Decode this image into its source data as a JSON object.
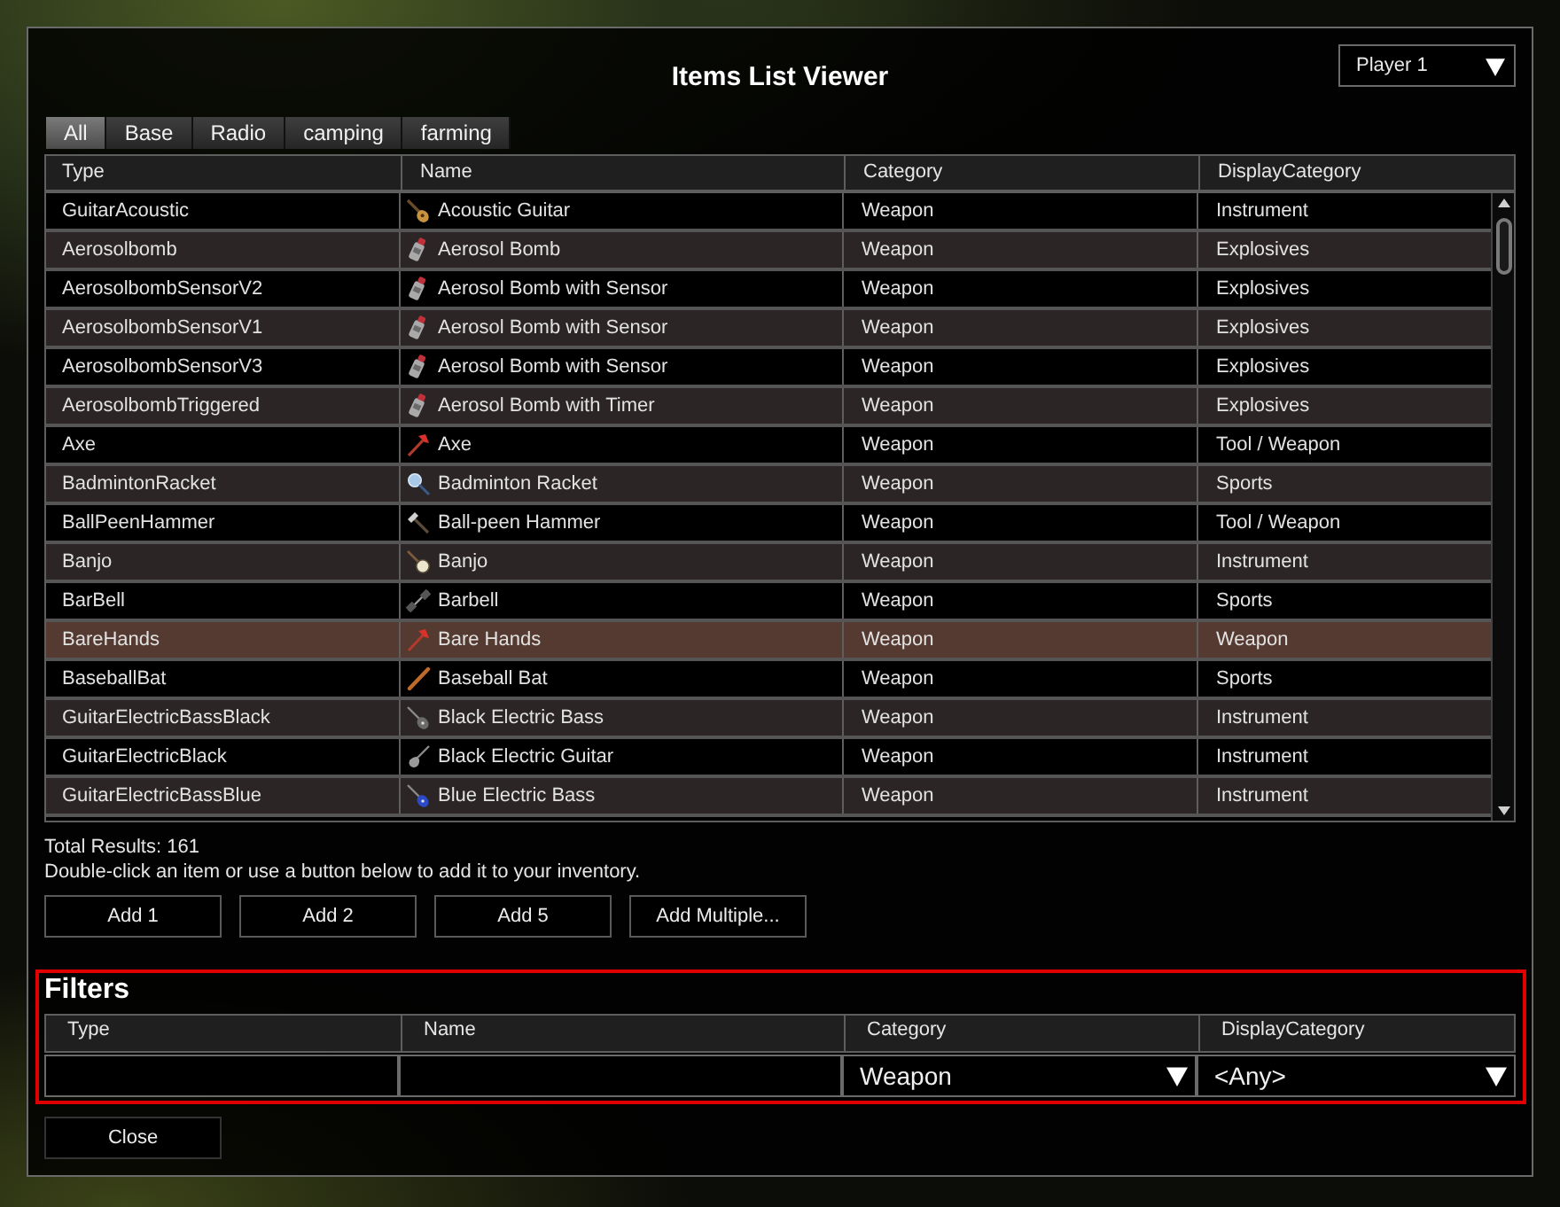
{
  "window": {
    "title": "Items List Viewer"
  },
  "player_select": {
    "value": "Player 1"
  },
  "tabs": [
    {
      "label": "All",
      "selected": true
    },
    {
      "label": "Base",
      "selected": false
    },
    {
      "label": "Radio",
      "selected": false
    },
    {
      "label": "camping",
      "selected": false
    },
    {
      "label": "farming",
      "selected": false
    }
  ],
  "table": {
    "columns": [
      "Type",
      "Name",
      "Category",
      "DisplayCategory"
    ],
    "rows": [
      {
        "type": "GuitarAcoustic",
        "name": "Acoustic Guitar",
        "category": "Weapon",
        "display_category": "Instrument",
        "selected": false
      },
      {
        "type": "Aerosolbomb",
        "name": "Aerosol Bomb",
        "category": "Weapon",
        "display_category": "Explosives",
        "selected": false
      },
      {
        "type": "AerosolbombSensorV2",
        "name": "Aerosol Bomb with Sensor",
        "category": "Weapon",
        "display_category": "Explosives",
        "selected": false
      },
      {
        "type": "AerosolbombSensorV1",
        "name": "Aerosol Bomb with Sensor",
        "category": "Weapon",
        "display_category": "Explosives",
        "selected": false
      },
      {
        "type": "AerosolbombSensorV3",
        "name": "Aerosol Bomb with Sensor",
        "category": "Weapon",
        "display_category": "Explosives",
        "selected": false
      },
      {
        "type": "AerosolbombTriggered",
        "name": "Aerosol Bomb with Timer",
        "category": "Weapon",
        "display_category": "Explosives",
        "selected": false
      },
      {
        "type": "Axe",
        "name": "Axe",
        "category": "Weapon",
        "display_category": "Tool / Weapon",
        "selected": false
      },
      {
        "type": "BadmintonRacket",
        "name": "Badminton Racket",
        "category": "Weapon",
        "display_category": "Sports",
        "selected": false
      },
      {
        "type": "BallPeenHammer",
        "name": "Ball-peen Hammer",
        "category": "Weapon",
        "display_category": "Tool / Weapon",
        "selected": false
      },
      {
        "type": "Banjo",
        "name": "Banjo",
        "category": "Weapon",
        "display_category": "Instrument",
        "selected": false
      },
      {
        "type": "BarBell",
        "name": "Barbell",
        "category": "Weapon",
        "display_category": "Sports",
        "selected": false
      },
      {
        "type": "BareHands",
        "name": "Bare Hands",
        "category": "Weapon",
        "display_category": "Weapon",
        "selected": true
      },
      {
        "type": "BaseballBat",
        "name": "Baseball Bat",
        "category": "Weapon",
        "display_category": "Sports",
        "selected": false
      },
      {
        "type": "GuitarElectricBassBlack",
        "name": "Black Electric Bass",
        "category": "Weapon",
        "display_category": "Instrument",
        "selected": false
      },
      {
        "type": "GuitarElectricBlack",
        "name": "Black Electric Guitar",
        "category": "Weapon",
        "display_category": "Instrument",
        "selected": false
      },
      {
        "type": "GuitarElectricBassBlue",
        "name": "Blue Electric Bass",
        "category": "Weapon",
        "display_category": "Instrument",
        "selected": false
      }
    ]
  },
  "total_results": "Total Results: 161",
  "hint": "Double-click an item or use a button below to add it to your inventory.",
  "buttons": [
    "Add 1",
    "Add 2",
    "Add 5",
    "Add Multiple..."
  ],
  "filters": {
    "title": "Filters",
    "highlighted": true,
    "columns": [
      "Type",
      "Name",
      "Category",
      "DisplayCategory"
    ],
    "fields": [
      {
        "kind": "text"
      },
      {
        "kind": "text"
      },
      {
        "kind": "select",
        "value": "Weapon"
      },
      {
        "kind": "select",
        "value": "<Any>"
      }
    ]
  },
  "close_button": "Close"
}
